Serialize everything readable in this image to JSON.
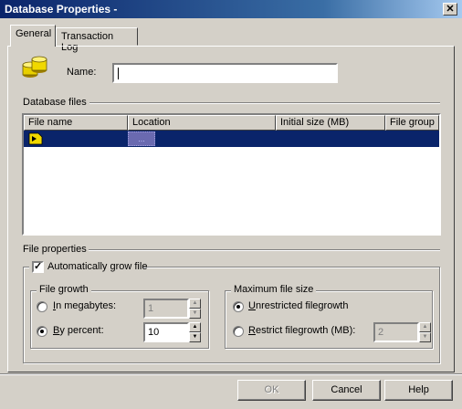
{
  "window": {
    "title": "Database Properties -"
  },
  "tabs": [
    {
      "label": "General"
    },
    {
      "label": "Transaction Log"
    }
  ],
  "name_field": {
    "label": "Name:",
    "value": ""
  },
  "database_files": {
    "section_label": "Database files",
    "columns": [
      "File name",
      "Location",
      "Initial size (MB)",
      "File group"
    ],
    "rows": [
      {
        "file_name": "",
        "location": "...",
        "initial_size": "",
        "file_group": ""
      }
    ]
  },
  "file_properties": {
    "section_label": "File properties",
    "auto_grow_label": "Automatically grow file",
    "auto_grow_checked": true,
    "file_growth": {
      "legend": "File growth",
      "in_megabytes_label": "In megabytes:",
      "in_megabytes_value": "1",
      "by_percent_label": "By percent:",
      "by_percent_value": "10",
      "selected": "by_percent"
    },
    "max_file_size": {
      "legend": "Maximum file size",
      "unrestricted_label": "Unrestricted filegrowth",
      "restrict_label": "Restrict filegrowth (MB):",
      "restrict_value": "2",
      "selected": "unrestricted"
    }
  },
  "buttons": {
    "ok": "OK",
    "cancel": "Cancel",
    "help": "Help"
  },
  "icons": {
    "title_close": "close-icon",
    "database": "database-icon",
    "file_row": "data-file-icon"
  }
}
